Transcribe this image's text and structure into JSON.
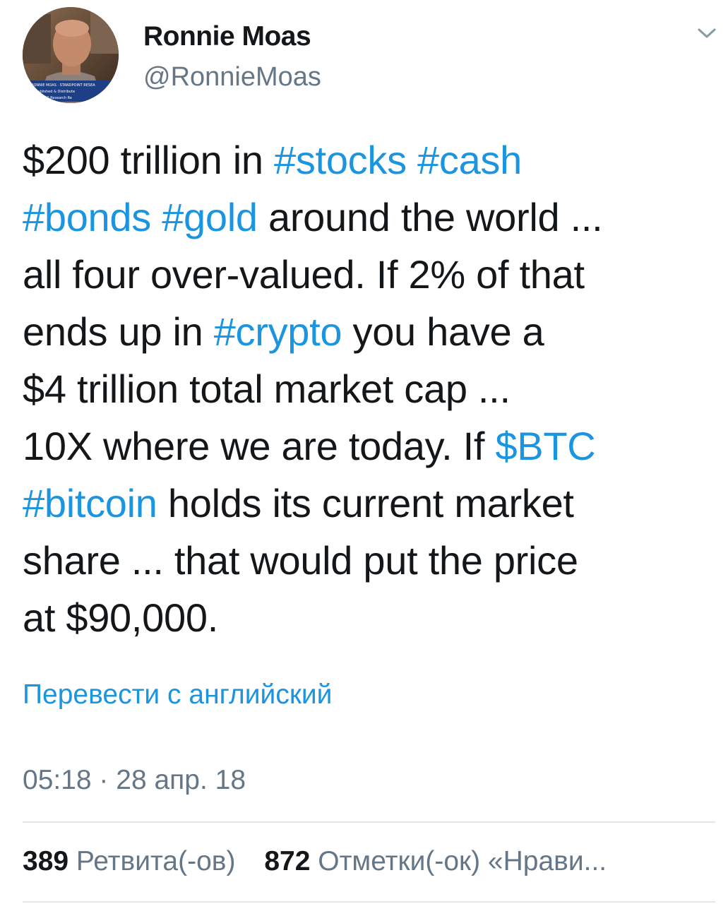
{
  "author": {
    "display_name": "Ronnie Moas",
    "handle": "@RonnieMoas"
  },
  "tweet": {
    "lines": [
      [
        {
          "text": "$200 trillion in ",
          "link": false
        },
        {
          "text": "#stocks",
          "link": true
        },
        {
          "text": " ",
          "link": false
        },
        {
          "text": "#cash",
          "link": true
        }
      ],
      [
        {
          "text": "#bonds",
          "link": true
        },
        {
          "text": " ",
          "link": false
        },
        {
          "text": "#gold",
          "link": true
        },
        {
          "text": " around the world ...",
          "link": false
        }
      ],
      [
        {
          "text": "all four over-valued. If 2% of that",
          "link": false
        }
      ],
      [
        {
          "text": "ends up in ",
          "link": false
        },
        {
          "text": "#crypto",
          "link": true
        },
        {
          "text": " you have a",
          "link": false
        }
      ],
      [
        {
          "text": "$4 trillion total market cap ...",
          "link": false
        }
      ],
      [
        {
          "text": "10X where we are today. If ",
          "link": false
        },
        {
          "text": "$BTC",
          "link": true
        }
      ],
      [
        {
          "text": "#bitcoin",
          "link": true
        },
        {
          "text": " holds its current market",
          "link": false
        }
      ],
      [
        {
          "text": "share ... that would put the price",
          "link": false
        }
      ],
      [
        {
          "text": "at $90,000.",
          "link": false
        }
      ]
    ],
    "translate_label": "Перевести с английский",
    "timestamp": "05:18 · 28 апр. 18"
  },
  "stats": {
    "retweets_count": "389",
    "retweets_label": "Ретвита(-ов)",
    "likes_count": "872",
    "likes_label": "Отметки(-ок) «Нрави..."
  },
  "avatar": {
    "caption_lines": [
      "RONNIE MOAS · STANDPOINT RESEA",
      "d, Published & Distribute",
      "900 Research Re"
    ]
  },
  "icons": {
    "menu": "chevron-down-icon",
    "avatar": "avatar-photo"
  },
  "colors": {
    "link": "#1b95e0",
    "secondary_text": "#657786",
    "primary_text": "#14171a",
    "divider": "#e1e8ed"
  }
}
